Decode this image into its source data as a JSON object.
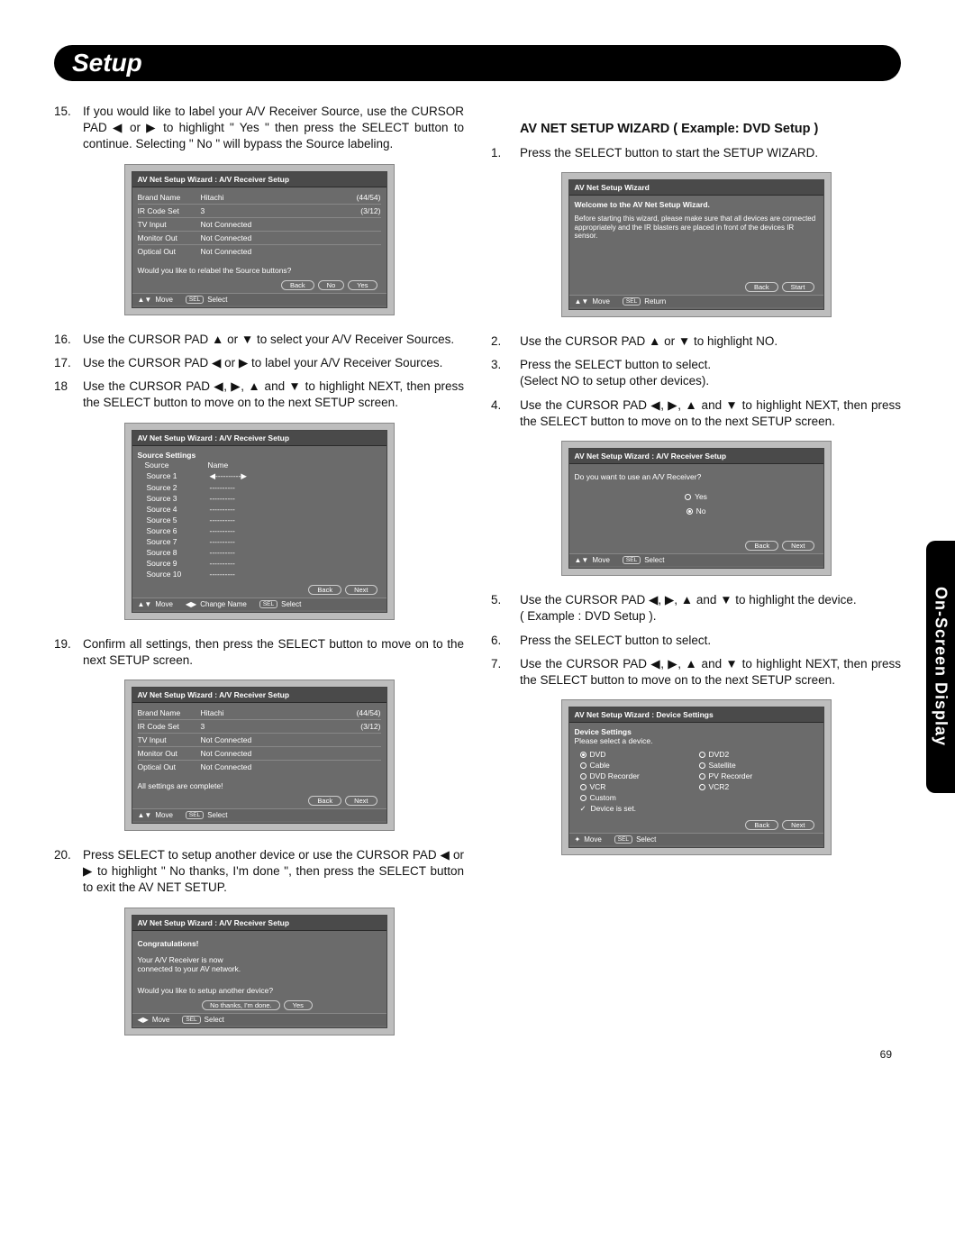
{
  "header": {
    "title": "Setup"
  },
  "side_tab": "On-Screen Display",
  "page_number": "69",
  "left": {
    "i15": "If you would like to label your A/V Receiver Source, use the CURSOR PAD ◀ or ▶ to highlight \" Yes \" then press the SELECT button to continue. Selecting \" No \" will bypass the Source labeling.",
    "i16": "Use the CURSOR PAD ▲ or ▼ to select your A/V Receiver Sources.",
    "i17": "Use the CURSOR PAD ◀ or ▶ to label your A/V Receiver Sources.",
    "i18": "Use the CURSOR PAD ◀, ▶, ▲ and ▼ to highlight NEXT, then press the SELECT button to move on to the next SETUP screen.",
    "i19": "Confirm all settings, then press the SELECT button to move on to the next SETUP screen.",
    "i20": "Press SELECT to setup another device or use the CURSOR PAD ◀ or ▶ to highlight \" No thanks, I'm done \", then press the SELECT button to exit the AV NET SETUP."
  },
  "right": {
    "heading": "AV NET SETUP WIZARD ( Example: DVD Setup )",
    "i1": "Press the SELECT button to start the SETUP WIZARD.",
    "i2": "Use the CURSOR PAD ▲ or ▼ to highlight NO.",
    "i3": "Press the SELECT button to select.\n(Select NO to setup other devices).",
    "i4": "Use the CURSOR PAD ◀, ▶, ▲ and ▼ to highlight NEXT, then press the SELECT button to move on to the next SETUP screen.",
    "i5": "Use the CURSOR PAD ◀, ▶, ▲ and ▼ to highlight the device.\n( Example : DVD Setup ).",
    "i6": "Press the SELECT button to select.",
    "i7": "Use the CURSOR PAD ◀, ▶, ▲ and ▼ to highlight NEXT, then press the SELECT button to move on to the next SETUP screen."
  },
  "osd_common": {
    "title_avr": "AV Net Setup Wizard : A/V Receiver Setup",
    "title_wiz": "AV Net Setup Wizard",
    "title_dev": "AV Net Setup Wizard : Device Settings",
    "brand_label": "Brand Name",
    "brand_val": "Hitachi",
    "brand_extra": "(44/54)",
    "ir_label": "IR Code Set",
    "ir_val": "3",
    "ir_extra": "(3/12)",
    "tv_label": "TV Input",
    "tv_val": "Not Connected",
    "mon_label": "Monitor Out",
    "mon_val": "Not Connected",
    "opt_label": "Optical Out",
    "opt_val": "Not Connected",
    "q_relabel": "Would you like to relabel the Source buttons?",
    "btn_back": "Back",
    "btn_no": "No",
    "btn_yes": "Yes",
    "btn_next": "Next",
    "btn_start": "Start",
    "foot_move": "Move",
    "foot_select": "Select",
    "foot_change": "Change Name",
    "foot_return": "Return",
    "sel": "SEL"
  },
  "osd2": {
    "header1": "Source Settings",
    "col1": "Source",
    "col2": "Name",
    "rows": [
      "Source 1",
      "Source 2",
      "Source 3",
      "Source 4",
      "Source 5",
      "Source 6",
      "Source 7",
      "Source 8",
      "Source 9",
      "Source 10"
    ],
    "dashes": "----------"
  },
  "osd3": {
    "msg": "All settings are complete!"
  },
  "osd4": {
    "congrats": "Congratulations!",
    "msg1": "Your A/V Receiver is now",
    "msg2": "connected to your AV network.",
    "q": "Would you like to setup another device?",
    "btn_done": "No thanks, I'm done."
  },
  "osd5": {
    "welcome": "Welcome to the AV Net Setup Wizard.",
    "msg": "Before starting this wizard, please make sure that all devices are connected appropriately and the IR blasters are placed in front of the devices IR sensor."
  },
  "osd6": {
    "q": "Do you want to use an A/V Receiver?",
    "yes": "Yes",
    "no": "No"
  },
  "osd7": {
    "h": "Device Settings",
    "sub": "Please select a device.",
    "d_dvd": "DVD",
    "d_dvd2": "DVD2",
    "d_cable": "Cable",
    "d_sat": "Satellite",
    "d_dvdr": "DVD Recorder",
    "d_pvr": "PV Recorder",
    "d_vcr": "VCR",
    "d_vcr2": "VCR2",
    "d_custom": "Custom",
    "d_set": "Device is set."
  }
}
